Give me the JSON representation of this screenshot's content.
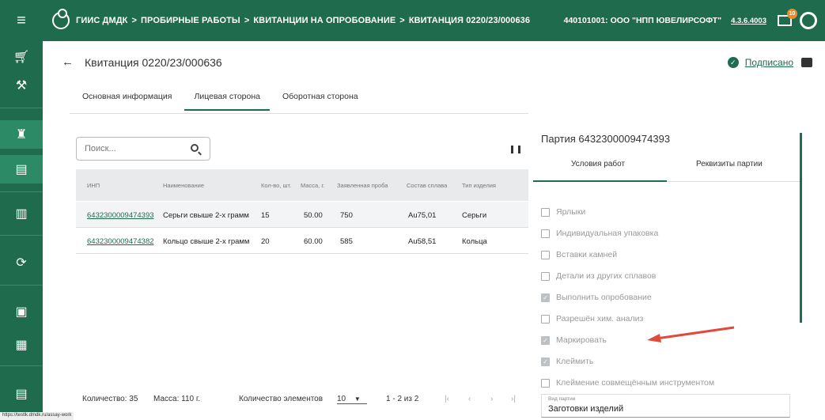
{
  "header": {
    "breadcrumbs": [
      "ГИИС ДМДК",
      "ПРОБИРНЫЕ РАБОТЫ",
      "КВИТАНЦИИ НА ОПРОБОВАНИЕ",
      "КВИТАНЦИЯ 0220/23/000636"
    ],
    "separator": ">",
    "org": "440101001: ООО \"НПП ЮВЕЛИРСОФТ\"",
    "version": "4.3.6.4003",
    "mail_badge": "10"
  },
  "page": {
    "title": "Квитанция 0220/23/000636",
    "status": "Подписано"
  },
  "tabs": [
    "Основная информация",
    "Лицевая сторона",
    "Оборотная сторона"
  ],
  "search": {
    "placeholder": "Поиск..."
  },
  "table": {
    "columns": [
      "ИНП",
      "Наименование",
      "Кол-во, шт.",
      "Масса, г.",
      "Заявленная проба",
      "Состав сплава",
      "Тип изделия"
    ],
    "rows": [
      [
        "6432300009474393",
        "Серьги свыше 2-х грамм",
        "15",
        "50.00",
        "750",
        "Au75,01",
        "Серьги"
      ],
      [
        "6432300009474382",
        "Кольцо свыше 2-х грамм",
        "20",
        "60.00",
        "585",
        "Au58,51",
        "Кольца"
      ]
    ]
  },
  "footer": {
    "count": "Количество: 35",
    "mass": "Масса: 110 г.",
    "items_label": "Количество элементов",
    "items_value": "10",
    "range": "1 - 2 из 2"
  },
  "panel": {
    "title": "Партия 6432300009474393",
    "tabs": [
      "Условия работ",
      "Реквизиты партии"
    ],
    "checkboxes": [
      {
        "label": "Ярлыки",
        "checked": false
      },
      {
        "label": "Индивидуальная упаковка",
        "checked": false
      },
      {
        "label": "Вставки камней",
        "checked": false
      },
      {
        "label": "Детали из других сплавов",
        "checked": false
      },
      {
        "label": "Выполнить опробование",
        "checked": true
      },
      {
        "label": "Разрешён хим. анализ",
        "checked": false
      },
      {
        "label": "Маркировать",
        "checked": true
      },
      {
        "label": "Клеймить",
        "checked": true
      },
      {
        "label": "Клеймение совмещённым инструментом",
        "checked": false
      }
    ],
    "field": {
      "label": "Вид партии",
      "value": "Заготовки изделий"
    }
  },
  "status_url": "https://testlk.dmdk.ru/assay-work",
  "colors": {
    "brand": "#1f6b4d",
    "arrow": "#e04a3a",
    "badge": "#f08a24"
  }
}
